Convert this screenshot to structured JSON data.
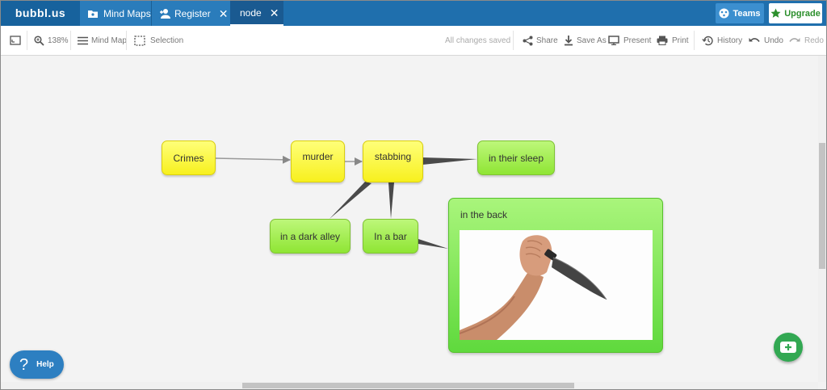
{
  "app": {
    "logo": "bubbl.us"
  },
  "tabs": [
    {
      "label": "Mind Maps"
    },
    {
      "label": "Register"
    },
    {
      "label": "node"
    }
  ],
  "header": {
    "teams_label": "Teams",
    "upgrade_label": "Upgrade"
  },
  "toolbar": {
    "zoom": "138%",
    "mindmap_label": "Mind Map",
    "selection_label": "Selection",
    "status": "All changes saved",
    "share_label": "Share",
    "saveas_label": "Save As",
    "present_label": "Present",
    "print_label": "Print",
    "history_label": "History",
    "undo_label": "Undo",
    "redo_label": "Redo"
  },
  "mindmap": {
    "nodes": {
      "crimes": "Crimes",
      "murder": "murder",
      "stabbing": "stabbing",
      "sleep": "in their sleep",
      "alley": "in a dark alley",
      "bar": "In a bar",
      "back": "in the back"
    },
    "colors": {
      "yellow": "#f7f01e",
      "green": "#8fe534"
    }
  },
  "help_label": "Help",
  "accent": "#1f6fad"
}
